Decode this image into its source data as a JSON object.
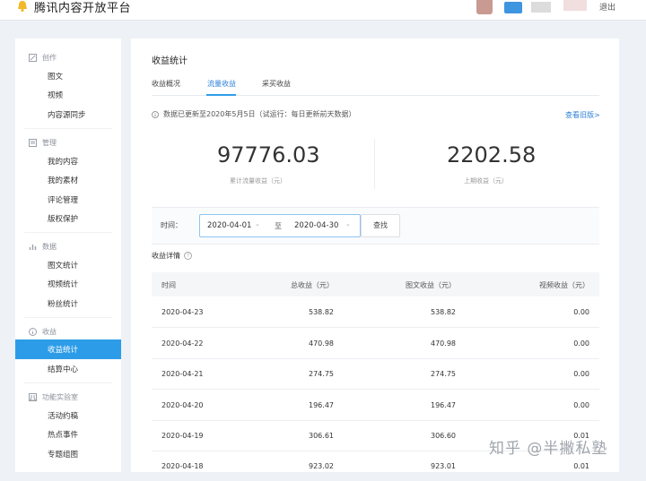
{
  "header": {
    "brand": "腾讯内容开放平台",
    "logout": "退出"
  },
  "sidebar": {
    "sections": [
      {
        "title": "创作",
        "items": [
          "图文",
          "视频",
          "内容源同步"
        ]
      },
      {
        "title": "管理",
        "items": [
          "我的内容",
          "我的素材",
          "评论管理",
          "版权保护"
        ]
      },
      {
        "title": "数据",
        "items": [
          "图文统计",
          "视频统计",
          "粉丝统计"
        ]
      },
      {
        "title": "收益",
        "items": [
          "收益统计",
          "结算中心"
        ]
      },
      {
        "title": "功能实验室",
        "items": [
          "活动约稿",
          "热点事件",
          "专题组图"
        ]
      }
    ],
    "active_item": "收益统计"
  },
  "main": {
    "title": "收益统计",
    "tabs": [
      "收益概况",
      "流量收益",
      "采买收益"
    ],
    "active_tab": "流量收益",
    "notice": "数据已更新至2020年5月5日（试运行：每日更新前天数据）",
    "history_link": "查看旧版>",
    "stats": {
      "total_value": "97776.03",
      "total_label": "累计流量收益（元）",
      "month_value": "2202.58",
      "month_label": "上期收益（元）"
    },
    "filter": {
      "time_label": "时间：",
      "start_date": "2020-04-01",
      "to": "至",
      "end_date": "2020-04-30",
      "query_button": "查找"
    },
    "detail_title": "收益详情",
    "table": {
      "headers": [
        "时间",
        "总收益（元）",
        "图文收益（元）",
        "视频收益（元）"
      ],
      "rows": [
        [
          "2020-04-23",
          "538.82",
          "538.82",
          "0.00"
        ],
        [
          "2020-04-22",
          "470.98",
          "470.98",
          "0.00"
        ],
        [
          "2020-04-21",
          "274.75",
          "274.75",
          "0.00"
        ],
        [
          "2020-04-20",
          "196.47",
          "196.47",
          "0.00"
        ],
        [
          "2020-04-19",
          "306.61",
          "306.60",
          "0.01"
        ],
        [
          "2020-04-18",
          "923.02",
          "923.01",
          "0.01"
        ]
      ]
    }
  },
  "watermark": "知乎 @半撇私塾",
  "colors": {
    "accent": "#2d9ce8",
    "link": "#2d7fd6",
    "background": "#eef1f6"
  }
}
